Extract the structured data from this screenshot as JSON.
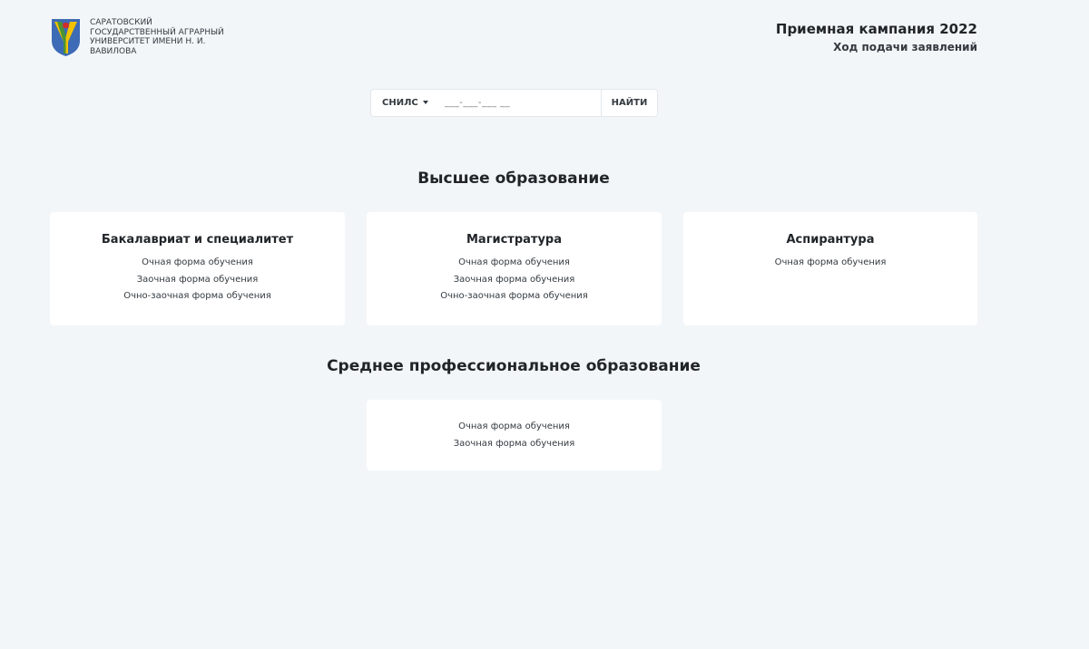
{
  "header": {
    "university_name": "САРАТОВСКИЙ ГОСУДАРСТВЕННЫЙ АГРАРНЫЙ УНИВЕРСИТЕТ ИМЕНИ Н. И. ВАВИЛОВА",
    "campaign_title": "Приемная кампания 2022",
    "campaign_subtitle": "Ход подачи заявлений"
  },
  "search": {
    "doc_type_label": "СНИЛС",
    "input_placeholder": "___-___-___ __",
    "button_label": "НАЙТИ"
  },
  "sections": {
    "higher": {
      "title": "Высшее образование",
      "cards": [
        {
          "title": "Бакалавриат и специалитет",
          "links": [
            "Очная форма обучения",
            "Заочная форма обучения",
            "Очно-заочная форма обучения"
          ]
        },
        {
          "title": "Магистратура",
          "links": [
            "Очная форма обучения",
            "Заочная форма обучения",
            "Очно-заочная форма обучения"
          ]
        },
        {
          "title": "Аспирантура",
          "links": [
            "Очная форма обучения"
          ]
        }
      ]
    },
    "spo": {
      "title": "Среднее профессиональное образование",
      "cards": [
        {
          "links": [
            "Очная форма обучения",
            "Заочная форма обучения"
          ]
        }
      ]
    }
  },
  "colors": {
    "background": "#f3f6f9",
    "card": "#ffffff",
    "emblem_blue": "#3d6bb5",
    "emblem_green": "#2e8b3d",
    "emblem_yellow": "#f2c200",
    "emblem_red": "#d22b2b"
  },
  "icons": {
    "logo": "university-emblem-icon",
    "dropdown": "caret-down-icon"
  }
}
